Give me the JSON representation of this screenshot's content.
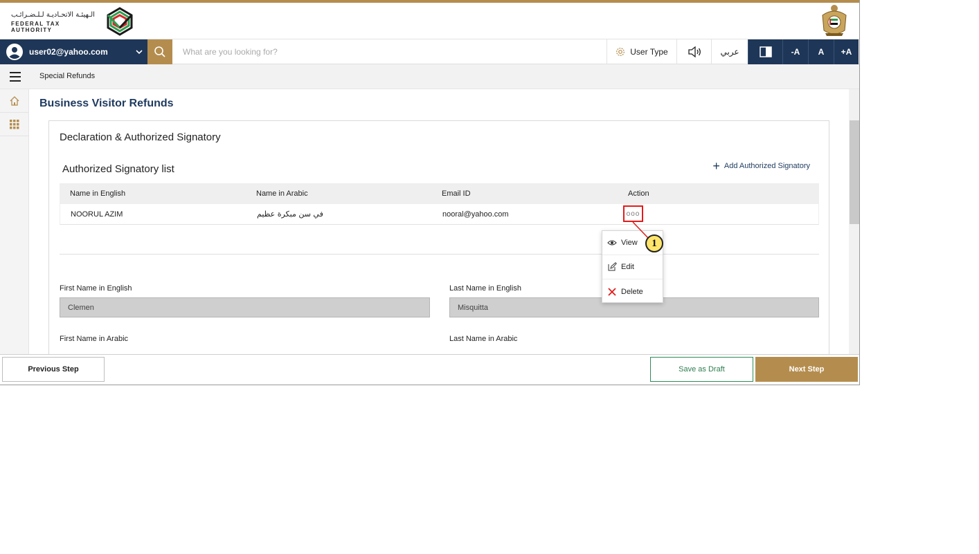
{
  "header": {
    "logo_ar": "الـهيئـة الاتحـاديـة لـلـضـرائـب",
    "logo_en": "FEDERAL TAX AUTHORITY"
  },
  "toolbar": {
    "user_email": "user02@yahoo.com",
    "search_placeholder": "What are you looking for?",
    "user_type_label": "User Type",
    "language_label": "عربي",
    "font_decrease": "-A",
    "font_normal": "A",
    "font_increase": "+A"
  },
  "breadcrumb": {
    "current": "Special Refunds"
  },
  "page": {
    "title": "Business Visitor Refunds",
    "section_title": "Declaration & Authorized Signatory",
    "list_title": "Authorized Signatory list",
    "add_link": "Add Authorized Signatory"
  },
  "table": {
    "headers": [
      "Name in English",
      "Name in Arabic",
      "Email ID",
      "Action"
    ],
    "rows": [
      {
        "name_en": "NOORUL AZIM",
        "name_ar": "في سن مبكرة عظيم",
        "email": "nooral@yahoo.com",
        "action": "ooo"
      }
    ]
  },
  "action_menu": {
    "items": [
      {
        "label": "View",
        "icon": "eye-icon"
      },
      {
        "label": "Edit",
        "icon": "edit-icon"
      },
      {
        "label": "Delete",
        "icon": "close-icon"
      }
    ]
  },
  "callout": {
    "number": "1",
    "color": "#ffe56b"
  },
  "form": {
    "first_name_en_label": "First Name in English",
    "first_name_en_value": "Clemen",
    "last_name_en_label": "Last Name in English",
    "last_name_en_value": "Misquitta",
    "first_name_ar_label": "First Name in Arabic",
    "last_name_ar_label": "Last Name in Arabic"
  },
  "footer": {
    "previous": "Previous Step",
    "save_draft": "Save as Draft",
    "next": "Next Step"
  },
  "colors": {
    "brand_gold": "#b48d4e",
    "navy": "#1e3657",
    "title_blue": "#1e3a5f",
    "highlight_red": "#e11b1b"
  }
}
